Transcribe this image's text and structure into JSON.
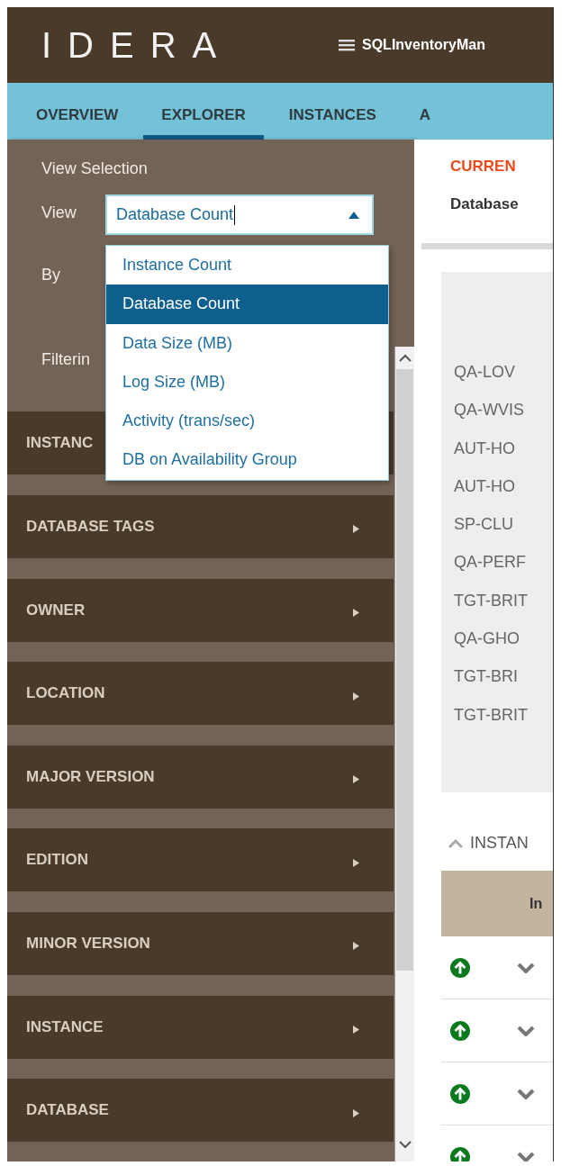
{
  "header": {
    "logo": "IDERA",
    "title": "SQLInventoryMan"
  },
  "tabs": [
    {
      "label": "OVERVIEW",
      "selected": false
    },
    {
      "label": "EXPLORER",
      "selected": true
    },
    {
      "label": "INSTANCES",
      "selected": false
    },
    {
      "label": "A",
      "selected": false
    }
  ],
  "view_selection": {
    "title": "View Selection",
    "view_label": "View",
    "view_value": "Database Count",
    "focused": true,
    "by_label": "By",
    "filtering_label": "Filterin",
    "dropdown": {
      "expanded": true,
      "options": [
        {
          "label": "Instance Count",
          "selected": false
        },
        {
          "label": "Database Count",
          "selected": true
        },
        {
          "label": "Data Size (MB)",
          "selected": false
        },
        {
          "label": "Log Size (MB)",
          "selected": false
        },
        {
          "label": "Activity (trans/sec)",
          "selected": false
        },
        {
          "label": "DB on Availability Group",
          "selected": false
        }
      ]
    }
  },
  "sections": [
    {
      "label": "INSTANC",
      "arrow": false
    },
    {
      "label": "DATABASE TAGS",
      "arrow": true
    },
    {
      "label": "OWNER",
      "arrow": true
    },
    {
      "label": "LOCATION",
      "arrow": true
    },
    {
      "label": "MAJOR VERSION",
      "arrow": true
    },
    {
      "label": "EDITION",
      "arrow": true
    },
    {
      "label": "MINOR VERSION",
      "arrow": true
    },
    {
      "label": "INSTANCE",
      "arrow": true
    },
    {
      "label": "DATABASE",
      "arrow": true
    }
  ],
  "main": {
    "heading": "CURREN",
    "subtitle": "Database",
    "instance_labels": [
      "QA-LOV",
      "QA-WVIS",
      "AUT-HO",
      "AUT-HO",
      "SP-CLU",
      "QA-PERF",
      "TGT-BRIT",
      "QA-GHO",
      "TGT-BRI",
      "TGT-BRIT"
    ],
    "instances_section": {
      "title": "INSTAN",
      "expanded": true
    },
    "table": {
      "columns": [
        "In"
      ],
      "rows": [
        {
          "expanded": false
        },
        {
          "expanded": false
        },
        {
          "expanded": false
        },
        {
          "expanded": false
        }
      ]
    }
  }
}
